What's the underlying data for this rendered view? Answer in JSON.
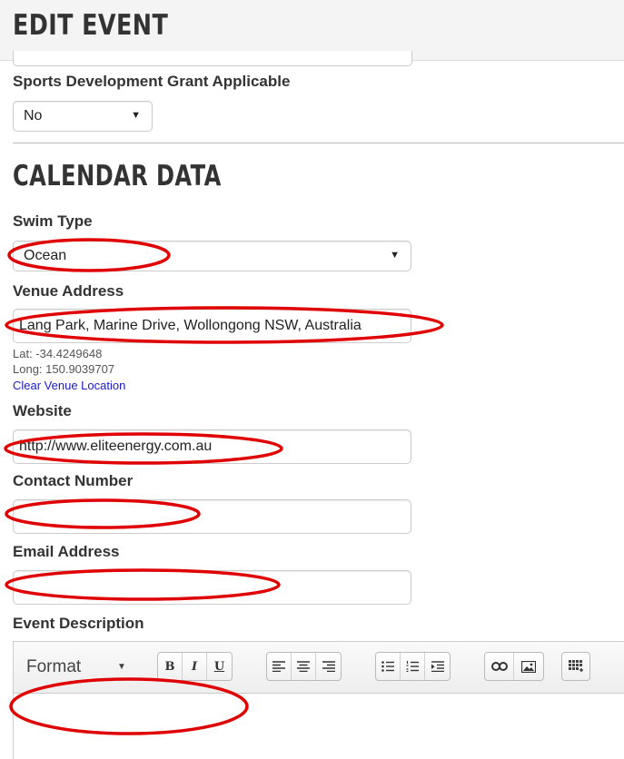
{
  "header": {
    "title": "Edit Event"
  },
  "grant": {
    "label": "Sports Development Grant Applicable",
    "selected": "No"
  },
  "calendar": {
    "title": "Calendar Data",
    "swim_type": {
      "label": "Swim Type",
      "selected": "Ocean"
    },
    "venue": {
      "label": "Venue Address",
      "value": "Lang Park, Marine Drive, Wollongong NSW, Australia",
      "lat": "Lat: -34.4249648",
      "long": "Long: 150.9039707",
      "clear_link": "Clear Venue Location"
    },
    "website": {
      "label": "Website",
      "value": "http://www.eliteenergy.com.au"
    },
    "contact": {
      "label": "Contact Number",
      "value": ""
    },
    "email": {
      "label": "Email Address",
      "value": ""
    },
    "description": {
      "label": "Event Description",
      "format_label": "Format",
      "toolbar_bold": "B",
      "toolbar_italic": "I",
      "toolbar_underline": "U"
    }
  },
  "annotation_color": "#e00000",
  "icons": [
    "chevron-down-icon",
    "bold-icon",
    "italic-icon",
    "underline-icon",
    "align-left-icon",
    "align-center-icon",
    "align-right-icon",
    "bulleted-list-icon",
    "numbered-list-icon",
    "indent-icon",
    "link-icon",
    "image-icon",
    "table-icon"
  ]
}
